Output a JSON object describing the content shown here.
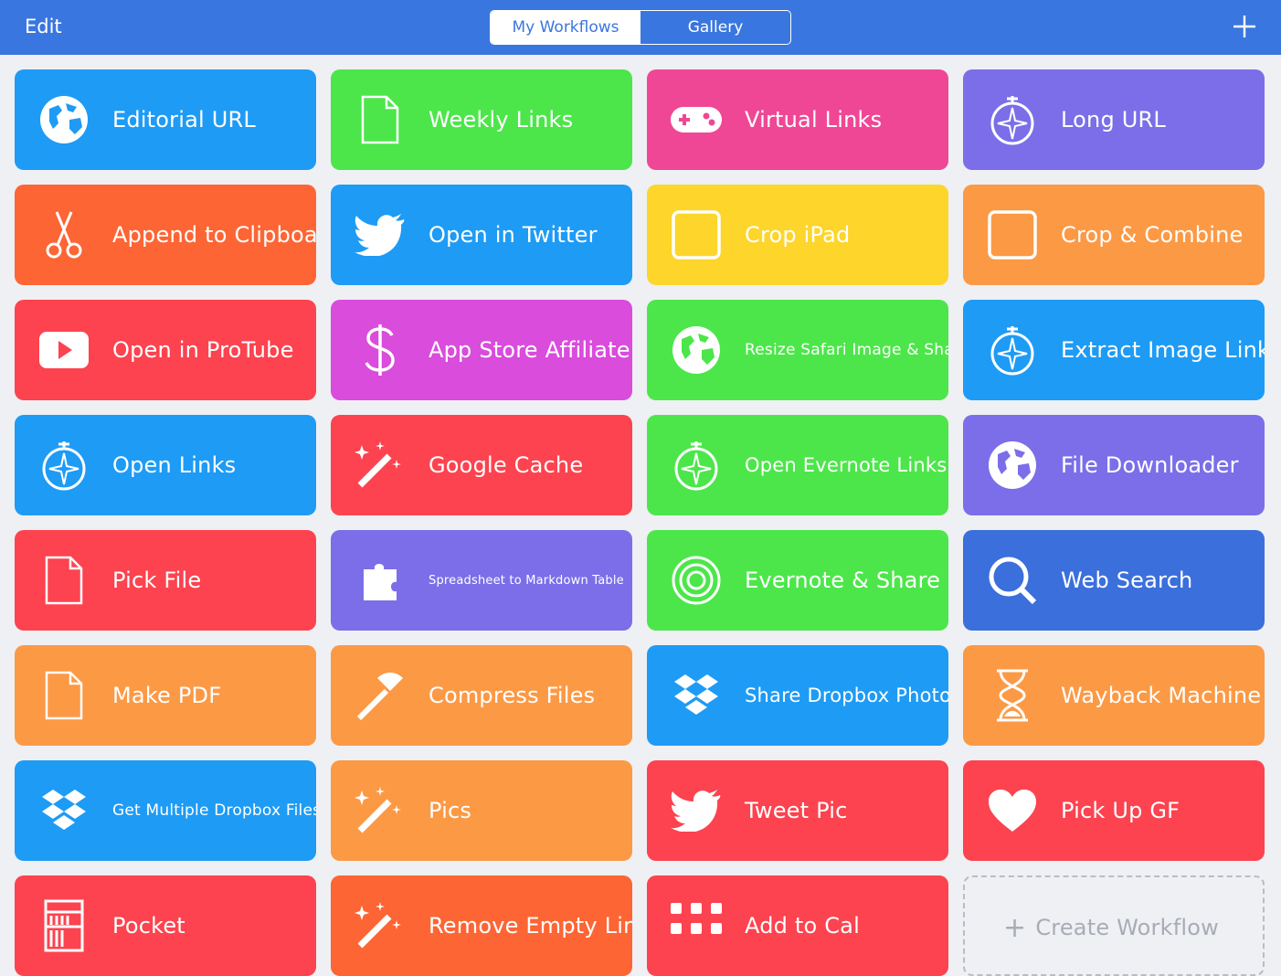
{
  "navbar": {
    "edit_label": "Edit",
    "tabs": [
      "My Workflows",
      "Gallery"
    ],
    "active_tab": "My Workflows",
    "add_icon": "plus-icon"
  },
  "colors": {
    "nav": "#3a76df",
    "blue": "#1e9bf5",
    "green": "#4ce64a",
    "pink": "#ef4795",
    "purple": "#7b6ee8",
    "orange_red": "#fd6534",
    "yellow": "#fdd52b",
    "orange": "#fc9945",
    "red": "#fc434f",
    "magenta": "#d94cdc",
    "indigo": "#3b6fdc"
  },
  "workflows": [
    {
      "title": "Editorial URL",
      "icon": "globe-icon",
      "color": "#1e9bf5"
    },
    {
      "title": "Weekly Links",
      "icon": "document-icon",
      "color": "#4ce64a"
    },
    {
      "title": "Virtual Links",
      "icon": "gamepad-icon",
      "color": "#ef4795"
    },
    {
      "title": "Long URL",
      "icon": "compass-icon",
      "color": "#7b6ee8"
    },
    {
      "title": "Append to Clipboard",
      "icon": "scissors-icon",
      "color": "#fd6534"
    },
    {
      "title": "Open in Twitter",
      "icon": "twitter-bird-icon",
      "color": "#1e9bf5"
    },
    {
      "title": "Crop iPad",
      "icon": "square-icon",
      "color": "#fdd52b"
    },
    {
      "title": "Crop & Combine",
      "icon": "square-icon",
      "color": "#fc9945"
    },
    {
      "title": "Open in ProTube",
      "icon": "play-button-icon",
      "color": "#fc434f"
    },
    {
      "title": "App Store Affiliate",
      "icon": "dollar-icon",
      "color": "#d94cdc"
    },
    {
      "title": "Resize Safari Image & Share",
      "icon": "globe-icon",
      "color": "#4ce64a",
      "small": true
    },
    {
      "title": "Extract Image Links",
      "icon": "compass-icon",
      "color": "#1e9bf5"
    },
    {
      "title": "Open Links",
      "icon": "compass-icon",
      "color": "#1e9bf5"
    },
    {
      "title": "Google Cache",
      "icon": "magic-wand-icon",
      "color": "#fc434f"
    },
    {
      "title": "Open Evernote Links",
      "icon": "compass-icon",
      "color": "#4ce64a",
      "medium": true
    },
    {
      "title": "File Downloader",
      "icon": "globe-icon",
      "color": "#7b6ee8"
    },
    {
      "title": "Pick File",
      "icon": "document-icon",
      "color": "#fc434f"
    },
    {
      "title": "Spreadsheet to Markdown Table",
      "icon": "puzzle-icon",
      "color": "#7b6ee8",
      "tiny": true
    },
    {
      "title": "Evernote & Share",
      "icon": "target-icon",
      "color": "#4ce64a"
    },
    {
      "title": "Web Search",
      "icon": "search-icon",
      "color": "#3b6fdc"
    },
    {
      "title": "Make PDF",
      "icon": "document-icon",
      "color": "#fc9945"
    },
    {
      "title": "Compress Files",
      "icon": "hammer-icon",
      "color": "#fc9945"
    },
    {
      "title": "Share Dropbox Photo",
      "icon": "dropbox-icon",
      "color": "#1e9bf5",
      "medium": true
    },
    {
      "title": "Wayback Machine",
      "icon": "hourglass-icon",
      "color": "#fc9945"
    },
    {
      "title": "Get Multiple Dropbox Files",
      "icon": "dropbox-icon",
      "color": "#1e9bf5",
      "small": true
    },
    {
      "title": "Pics",
      "icon": "magic-wand-icon",
      "color": "#fc9945"
    },
    {
      "title": "Tweet Pic",
      "icon": "twitter-bird-icon",
      "color": "#fc434f"
    },
    {
      "title": "Pick Up GF",
      "icon": "heart-icon",
      "color": "#fc434f"
    },
    {
      "title": "Pocket",
      "icon": "books-icon",
      "color": "#fc434f"
    },
    {
      "title": "Remove Empty Lines",
      "icon": "magic-wand-icon",
      "color": "#fd6534"
    },
    {
      "title": "Add to Cal",
      "icon": "grid-icon",
      "color": "#fc434f"
    }
  ],
  "create_workflow_label": "Create Workflow"
}
